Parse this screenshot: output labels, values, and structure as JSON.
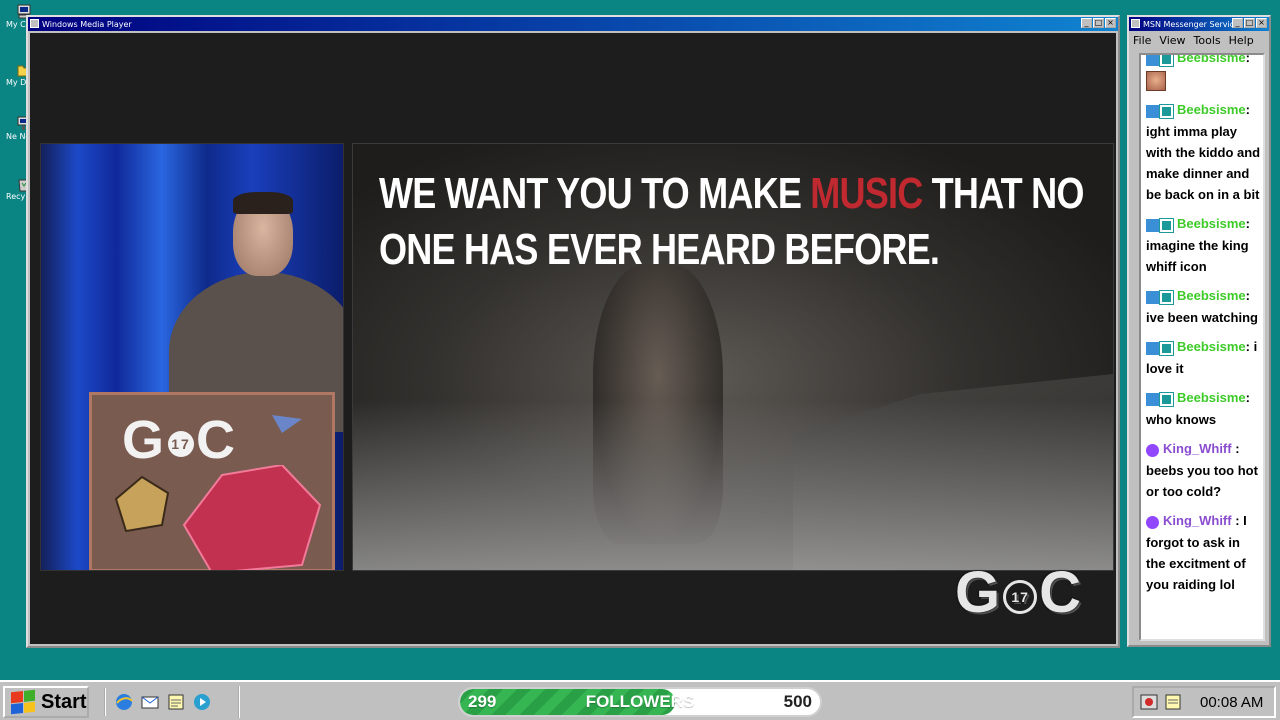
{
  "desktop": {
    "icons": [
      {
        "label": "My Co",
        "icon": "my-computer-icon"
      },
      {
        "label": "My Do",
        "icon": "my-documents-icon"
      },
      {
        "label": "Ne Neigh",
        "icon": "network-neighborhood-icon"
      },
      {
        "label": "Recy",
        "icon": "recycle-bin-icon"
      }
    ]
  },
  "media_player": {
    "title": "Windows Media Player",
    "slide": {
      "text_before": "We want you to make ",
      "text_highlight": "music",
      "text_after": " that no one has ever heard before.",
      "highlight_color": "#c0292f"
    },
    "podium_logo": {
      "left": "G",
      "number": "17",
      "right": "C"
    },
    "watermark": {
      "left": "G",
      "number": "17",
      "right": "C"
    }
  },
  "msn": {
    "title": "MSN Messenger Service",
    "menu": [
      "File",
      "View",
      "Tools",
      "Help"
    ],
    "messages": [
      {
        "user": "Beebsisme",
        "color": "green",
        "badges": [
          "mod",
          "sub"
        ],
        "text": ": ",
        "emote": "face-emote-icon"
      },
      {
        "user": "Beebsisme",
        "color": "green",
        "badges": [
          "mod",
          "sub"
        ],
        "text": ": ight imma play with the kiddo and make dinner and be back on in a bit"
      },
      {
        "user": "Beebsisme",
        "color": "green",
        "badges": [
          "mod",
          "sub"
        ],
        "text": ": imagine the king whiff icon"
      },
      {
        "user": "Beebsisme",
        "color": "green",
        "badges": [
          "mod",
          "sub"
        ],
        "text": ": ive been watching"
      },
      {
        "user": "Beebsisme",
        "color": "green",
        "badges": [
          "mod",
          "sub"
        ],
        "text": ": i love it"
      },
      {
        "user": "Beebsisme",
        "color": "green",
        "badges": [
          "mod",
          "sub"
        ],
        "text": ": who knows"
      },
      {
        "user": "King_Whiff",
        "color": "purple",
        "badges": [
          "prime"
        ],
        "text": " : beebs you too hot or too cold?"
      },
      {
        "user": "King_Whiff",
        "color": "purple",
        "badges": [
          "prime"
        ],
        "text": " : I forgot to ask in the excitment of you raiding lol"
      }
    ]
  },
  "taskbar": {
    "start_label": "Start",
    "quick_launch": [
      "ie-icon",
      "outlook-icon",
      "notepad-icon",
      "media-icon"
    ],
    "followers": {
      "current": "299",
      "label": "FOLLOWERS",
      "goal": "500",
      "progress": 0.598
    },
    "tray_icons": [
      "recording-icon",
      "messenger-tray-icon"
    ],
    "clock": "00:08 AM"
  },
  "colors": {
    "desktop": "#0b8484",
    "title_bar": "#000080",
    "chat_user_green": "#3ecb2a",
    "chat_user_purple": "#8a4dd0",
    "follower_bar": "#2aa046"
  }
}
